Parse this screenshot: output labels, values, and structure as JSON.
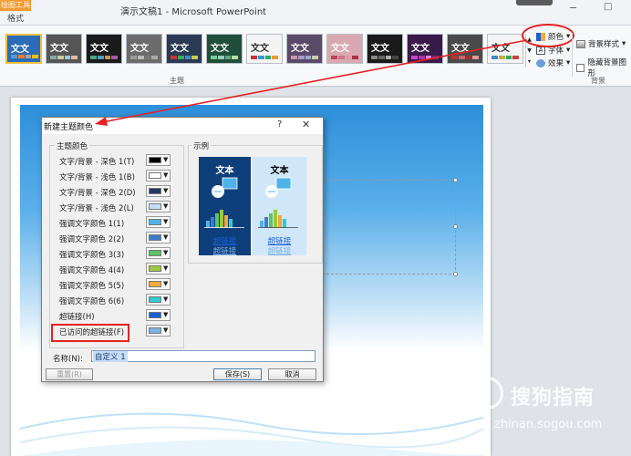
{
  "window": {
    "context_tab": "绘图工具",
    "active_tab": "格式",
    "title": "演示文稿1 - Microsoft PowerPoint",
    "min_glyph": "−",
    "max_glyph": "□"
  },
  "ribbon": {
    "theme_text": "文文",
    "themes": [
      {
        "bg": "#2b6cb8",
        "fg": "#ffffff",
        "bars": [
          "#5b9bd5",
          "#ed7d31",
          "#a5a5a5",
          "#ffc000"
        ]
      },
      {
        "bg": "#555555",
        "fg": "#ffffff",
        "bars": [
          "#8aa",
          "#cc9",
          "#9cd",
          "#dba"
        ]
      },
      {
        "bg": "#1a1a1a",
        "fg": "#ffffff",
        "bars": [
          "#4a7",
          "#59c",
          "#c94",
          "#a5a"
        ]
      },
      {
        "bg": "#6b6b6b",
        "fg": "#ffffff",
        "bars": [
          "#999",
          "#bbb",
          "#777",
          "#aaa"
        ]
      },
      {
        "bg": "#2a3a55",
        "fg": "#ffffff",
        "bars": [
          "#c33",
          "#3a6",
          "#48c",
          "#cc4"
        ]
      },
      {
        "bg": "#1f4f3a",
        "fg": "#ffffff",
        "bars": [
          "#7c9",
          "#9cb",
          "#5a8",
          "#bd9"
        ]
      },
      {
        "bg": "#f4f4f4",
        "fg": "#333333",
        "bars": [
          "#c33",
          "#39c",
          "#3a6",
          "#e93"
        ]
      },
      {
        "bg": "#5a4a6a",
        "fg": "#ffffff",
        "bars": [
          "#c9a",
          "#a9c",
          "#9ac",
          "#cca"
        ]
      },
      {
        "bg": "#d9a8b0",
        "fg": "#ffffff",
        "bars": [
          "#b45",
          "#c78",
          "#d9a",
          "#a34"
        ]
      },
      {
        "bg": "#1a1a1a",
        "fg": "#ffffff",
        "bars": [
          "#888",
          "#666",
          "#aaa",
          "#444"
        ]
      },
      {
        "bg": "#3a1a4a",
        "fg": "#ffffff",
        "bars": [
          "#c4c",
          "#a3a",
          "#d8d",
          "#737"
        ]
      },
      {
        "bg": "#4a4a4a",
        "fg": "#ffffff",
        "bars": [
          "#b33",
          "#c66",
          "#933",
          "#d99"
        ]
      },
      {
        "bg": "#f4f4f4",
        "fg": "#333333",
        "bars": [
          "#48c",
          "#ca4",
          "#3a6",
          "#c43"
        ]
      }
    ],
    "colors_label": "颜色",
    "fonts_label": "字体",
    "effects_label": "效果",
    "bg_styles_label": "背景样式",
    "hide_bg_label": "隐藏背景图形",
    "group_theme": "主题",
    "group_background": "背景"
  },
  "dialog": {
    "title": "新建主题颜色",
    "help": "?",
    "close": "✕",
    "theme_colors_heading": "主题颜色",
    "sample_heading": "示例",
    "rows": [
      {
        "label": "文字/背景 - 深色 1(T)",
        "color": "#000000"
      },
      {
        "label": "文字/背景 - 浅色 1(B)",
        "color": "#ffffff"
      },
      {
        "label": "文字/背景 - 深色 2(D)",
        "color": "#1f3864"
      },
      {
        "label": "文字/背景 - 浅色 2(L)",
        "color": "#c5dff5"
      },
      {
        "label": "强调文字颜色 1(1)",
        "color": "#4fb3ea"
      },
      {
        "label": "强调文字颜色 2(2)",
        "color": "#3d7cc9"
      },
      {
        "label": "强调文字颜色 3(3)",
        "color": "#5cc36a"
      },
      {
        "label": "强调文字颜色 4(4)",
        "color": "#9ac93e"
      },
      {
        "label": "强调文字颜色 5(5)",
        "color": "#f3a83b"
      },
      {
        "label": "强调文字颜色 6(6)",
        "color": "#2ecbd1"
      },
      {
        "label": "超链接(H)",
        "color": "#1b5fd6"
      },
      {
        "label": "已访问的超链接(F)",
        "color": "#7fb1e6"
      }
    ],
    "sample_text": "文本",
    "sample_link": "超链接",
    "name_label": "名称(N):",
    "name_value": "自定义 1",
    "reset_button": "重置(R)",
    "save_button": "保存(S)",
    "cancel_button": "取消"
  },
  "watermark": {
    "brand": "搜狗指南",
    "url": "zhinan.sogou.com"
  },
  "colors": {
    "annotation_red": "#e52222",
    "context_orange": "#f39a32"
  }
}
